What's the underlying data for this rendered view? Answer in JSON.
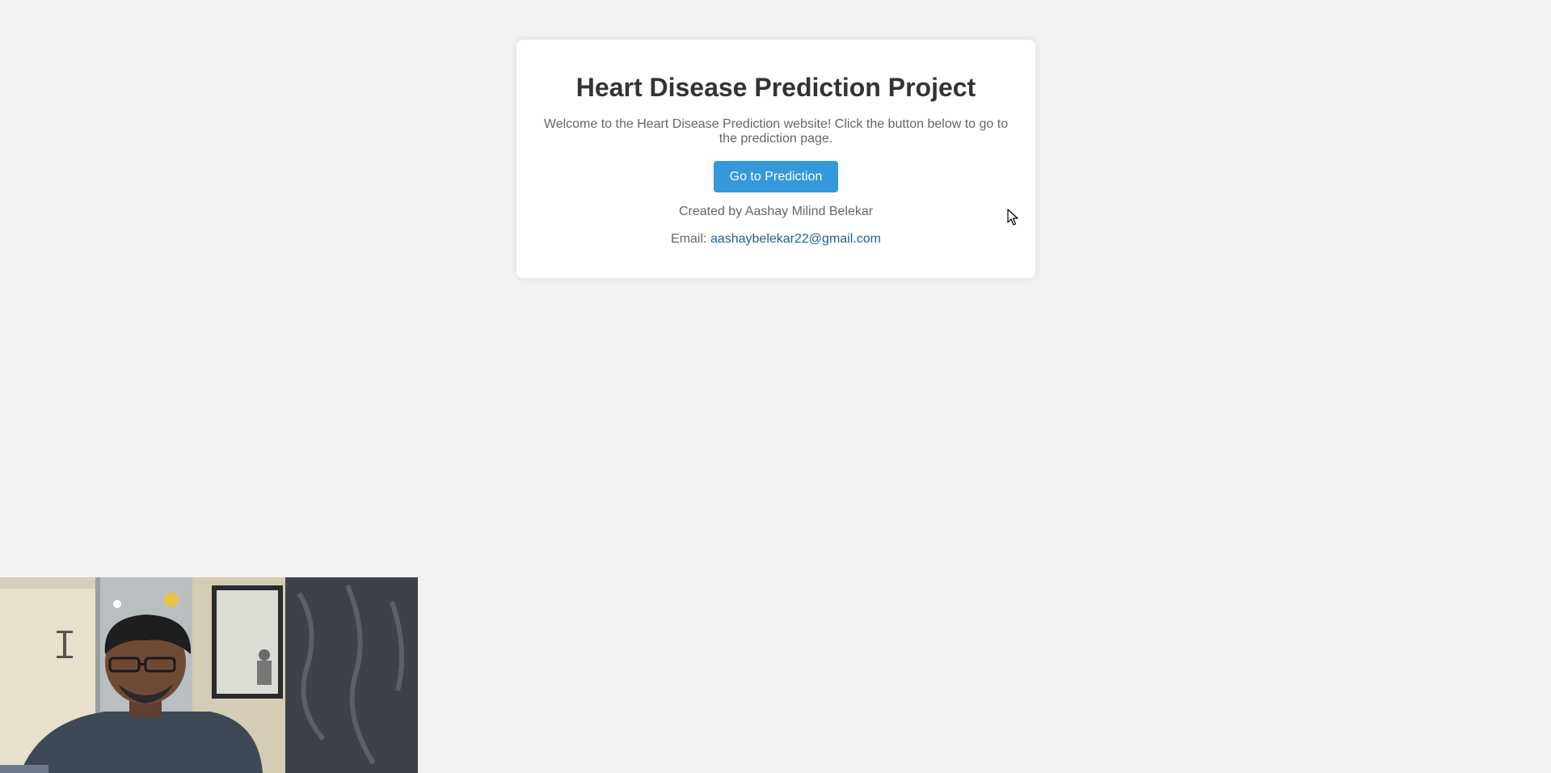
{
  "card": {
    "title": "Heart Disease Prediction Project",
    "intro": "Welcome to the Heart Disease Prediction website! Click the button below to go to the prediction page.",
    "button_label": "Go to Prediction",
    "credit": "Created by Aashay Milind Belekar",
    "email_label": "Email:",
    "email_address": "aashaybelekar22@gmail.com"
  },
  "colors": {
    "background": "#f2f2f2",
    "card": "#ffffff",
    "button": "#3498db",
    "link": "#1f5f8f"
  },
  "icons": {
    "cursor": "mouse-pointer-icon"
  }
}
